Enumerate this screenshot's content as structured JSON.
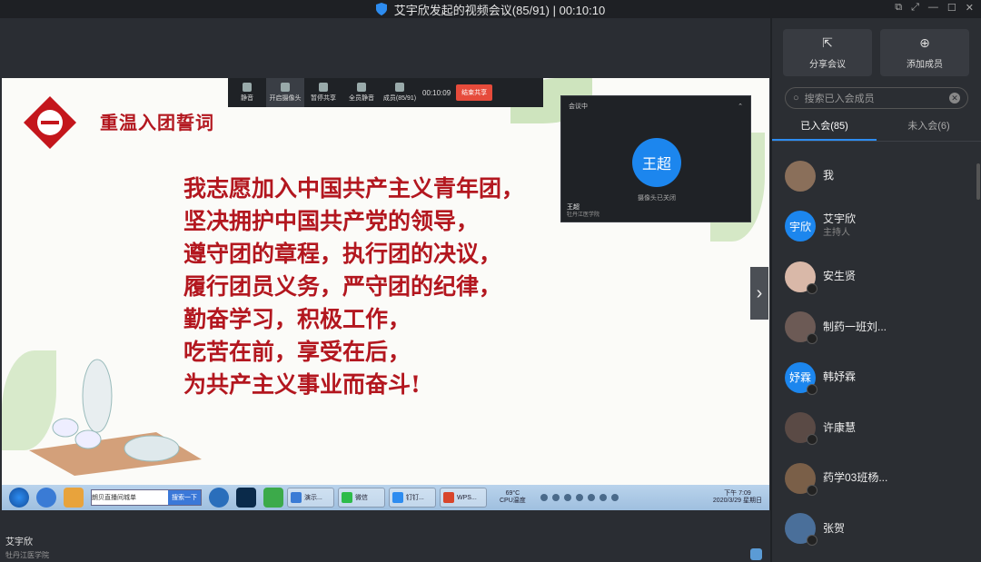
{
  "window": {
    "title": "艾宇欣发起的视频会议(85/91) | 00:10:10"
  },
  "toolbar": {
    "items": [
      {
        "label": "静音"
      },
      {
        "label": "开启摄像头"
      },
      {
        "label": "暂停共享"
      },
      {
        "label": "全员静音"
      },
      {
        "label": "成员(85/91)"
      }
    ],
    "timer": "00:10:09",
    "end_label": "结束共享"
  },
  "slide": {
    "title": "重温入团誓词",
    "oath_lines": [
      "我志愿加入中国共产主义青年团，",
      "坚决拥护中国共产党的领导，",
      "遵守团的章程，执行团的决议，",
      "履行团员义务，严守团的纪律，",
      "勤奋学习，积极工作，",
      "吃苦在前，享受在后，",
      "为共产主义事业而奋斗!"
    ]
  },
  "camera_panel": {
    "header": "会议中",
    "avatar_text": "王超",
    "status": "摄像头已关闭",
    "name": "王超",
    "school": "牡丹江医学院"
  },
  "taskbar": {
    "search_value": "朗贝直播间城单",
    "search_button": "搜索一下",
    "buttons": [
      {
        "label": "演示..."
      },
      {
        "label": "微信"
      },
      {
        "label": "钉钉..."
      },
      {
        "label": "WPS..."
      }
    ],
    "temp": "69°C",
    "temp_label": "CPU温度",
    "clock_time": "下午 7:09",
    "clock_date": "2020/3/29 星期日"
  },
  "presenter": {
    "name": "艾宇欣",
    "school": "牡丹江医学院"
  },
  "sidebar": {
    "share_label": "分享会议",
    "add_label": "添加成员",
    "search_placeholder": "搜索已入会成员",
    "tab_joined": "已入会(85)",
    "tab_not_joined": "未入会(6)",
    "members": [
      {
        "name": "我",
        "role": "",
        "avatar_text": "",
        "color": "#8a6f5a"
      },
      {
        "name": "艾宇欣",
        "role": "主持人",
        "avatar_text": "宇欣",
        "color": "#1c86ee"
      },
      {
        "name": "安生贤",
        "role": "",
        "avatar_text": "",
        "color": "#d9b8a8"
      },
      {
        "name": "制药一班刘...",
        "role": "",
        "avatar_text": "",
        "color": "#6c5a55"
      },
      {
        "name": "韩妤霖",
        "role": "",
        "avatar_text": "妤霖",
        "color": "#1c86ee"
      },
      {
        "name": "许康慧",
        "role": "",
        "avatar_text": "",
        "color": "#5a4a45"
      },
      {
        "name": "药学03班杨...",
        "role": "",
        "avatar_text": "",
        "color": "#7a5f48"
      },
      {
        "name": "张贺",
        "role": "",
        "avatar_text": "",
        "color": "#4a6f9a"
      }
    ]
  }
}
